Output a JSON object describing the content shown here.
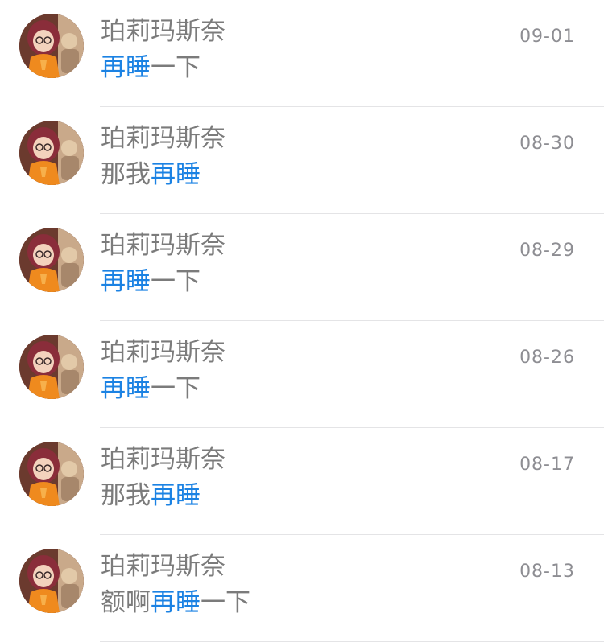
{
  "colors": {
    "highlight": "#1b82e3",
    "text": "#7b7b7b",
    "date": "#8e8e93",
    "divider": "#e4e4e6"
  },
  "results": [
    {
      "sender": "珀莉玛斯奈",
      "date": "09-01",
      "snippet_before": "",
      "snippet_match": "再睡",
      "snippet_after": "一下",
      "avatar_icon": "anime-girl-avatar"
    },
    {
      "sender": "珀莉玛斯奈",
      "date": "08-30",
      "snippet_before": "那我",
      "snippet_match": "再睡",
      "snippet_after": "",
      "avatar_icon": "anime-girl-avatar"
    },
    {
      "sender": "珀莉玛斯奈",
      "date": "08-29",
      "snippet_before": "",
      "snippet_match": "再睡",
      "snippet_after": "一下",
      "avatar_icon": "anime-girl-avatar"
    },
    {
      "sender": "珀莉玛斯奈",
      "date": "08-26",
      "snippet_before": "",
      "snippet_match": "再睡",
      "snippet_after": "一下",
      "avatar_icon": "anime-girl-avatar"
    },
    {
      "sender": "珀莉玛斯奈",
      "date": "08-17",
      "snippet_before": "那我",
      "snippet_match": "再睡",
      "snippet_after": "",
      "avatar_icon": "anime-girl-avatar"
    },
    {
      "sender": "珀莉玛斯奈",
      "date": "08-13",
      "snippet_before": "额啊",
      "snippet_match": "再睡",
      "snippet_after": "一下",
      "avatar_icon": "anime-girl-avatar"
    }
  ]
}
